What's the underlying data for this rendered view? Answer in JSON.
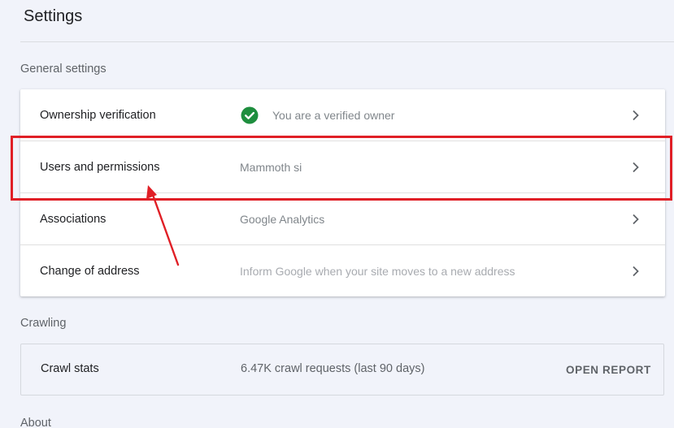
{
  "header": {
    "title": "Settings"
  },
  "general": {
    "section_label": "General settings",
    "rows": [
      {
        "label": "Ownership verification",
        "value": "You are a verified owner",
        "icon": "check-circle-icon"
      },
      {
        "label": "Users and permissions",
        "value": "Mammoth si"
      },
      {
        "label": "Associations",
        "value": "Google Analytics"
      },
      {
        "label": "Change of address",
        "value": "Inform Google when your site moves to a new address"
      }
    ]
  },
  "crawling": {
    "section_label": "Crawling",
    "crawl_stats": {
      "label": "Crawl stats",
      "value": "6.47K crawl requests (last 90 days)",
      "action": "OPEN REPORT"
    }
  },
  "about": {
    "section_label": "About"
  },
  "colors": {
    "verified_green": "#1e8e3e",
    "highlight_red": "#e01f26"
  }
}
